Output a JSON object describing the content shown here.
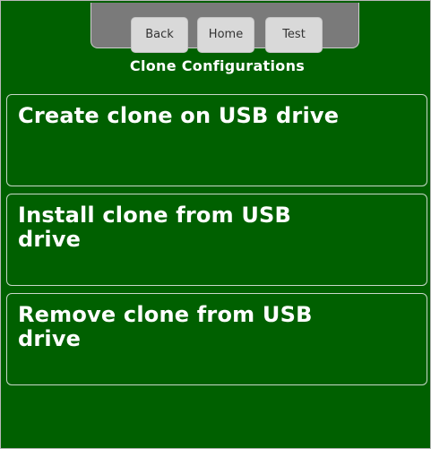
{
  "nav": {
    "back_label": "Back",
    "home_label": "Home",
    "test_label": "Test"
  },
  "page": {
    "title": "Clone Configurations"
  },
  "options": [
    {
      "label": "Create clone on USB drive"
    },
    {
      "label": "Install clone from USB drive"
    },
    {
      "label": "Remove clone from USB drive"
    }
  ],
  "colors": {
    "background": "#006000",
    "nav_panel": "#7a7a7a",
    "nav_button": "#d9d9d9",
    "text": "#ffffff"
  }
}
